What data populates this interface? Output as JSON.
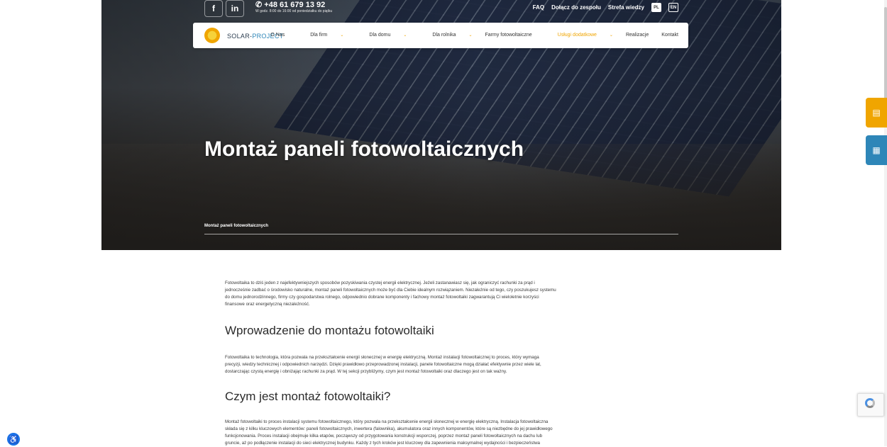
{
  "header": {
    "phone": "+48 61 679 13 92",
    "phone_hours": "W godz. 8:00 do 16:00 od poniedziałku do piątku",
    "social": {
      "facebook": "f",
      "linkedin": "in"
    },
    "top_links": {
      "faq": "FAQ",
      "join": "Dołącz do zespołu",
      "knowledge": "Strefa wiedzy"
    },
    "languages": {
      "pl": "PL",
      "en": "EN"
    }
  },
  "brand": {
    "name_part1": "SOLAR-",
    "name_part2": "PROJECT"
  },
  "nav": {
    "items": [
      {
        "label": "O Nas"
      },
      {
        "label": "Dla firm"
      },
      {
        "label": "Dla domu"
      },
      {
        "label": "Dla rolnika"
      },
      {
        "label": "Farmy fotowoltaiczne"
      },
      {
        "label": "Usługi dodatkowe"
      },
      {
        "label": "Realizacje"
      },
      {
        "label": "Kontakt"
      }
    ],
    "chevron": "⌄"
  },
  "hero": {
    "title": "Montaż paneli fotowoltaicznych",
    "breadcrumb": "Montaż paneli fotowoltaicznych"
  },
  "content": {
    "intro_lines": [
      "Fotowoltaika to dziś jeden z najefektywniejszych sposobów pozyskiwania czystej energii elektrycznej. Jeżeli zastanawiasz się, jak ograniczyć rachunki za prąd i",
      "jednocześnie zadbać o środowisko naturalne, montaż paneli fotowoltaicznych może być dla Ciebie idealnym rozwiązaniem. Niezależnie od tego, czy poszukujesz systemu",
      "do domu jednorodzinnego, firmy czy gospodarstwa rolnego, odpowiednio dobrane komponenty i fachowy montaż fotowoltaiki zagwarantują Ci wieloletnie korzyści",
      "finansowe oraz energetyczną niezależność."
    ],
    "heading1": "Wprowadzenie do montażu fotowoltaiki",
    "para1_lines": [
      "Fotowoltaika to technologia, która pozwala na przekształcenie energii słonecznej w energię elektryczną. Montaż instalacji fotowoltaicznej to proces, który wymaga",
      "precyzji, wiedzy technicznej i odpowiednich narzędzi. Dzięki prawidłowo przeprowadzonej instalacji, panele fotowoltaiczne mogą działać efektywnie przez wiele lat,",
      "dostarczając czystą energię i obniżając rachunki za prąd. W tej sekcji przybliżymy, czym jest montaż fotowoltaiki oraz dlaczego jest on tak ważny."
    ],
    "heading2": "Czym jest montaż fotowoltaiki?",
    "para2_lines": [
      "Montaż fotowoltaiki to proces instalacji systemu fotowoltaicznego, który pozwala na przekształcenie energii słonecznej w energię elektryczną. Instalacja fotowoltaiczna",
      "składa się z kilku kluczowych elementów: paneli fotowoltaicznych, inwertera (falownika), akumulatora oraz innych komponentów, które są niezbędne do jej prawidłowego",
      "funkcjonowania. Proces instalacji obejmuje kilka etapów, począwszy od przygotowania konstrukcji wsporczej, poprzez montaż paneli fotowoltaicznych na dachu lub",
      "gruncie, aż po podłączenie instalacji do sieci elektrycznej budynku. Każdy z tych kroków jest kluczowy dla zapewnienia maksymalnej wydajności i bezpieczeństwa"
    ]
  },
  "icons": {
    "phone": "phone-icon",
    "side_offer": "document-icon",
    "side_calc": "calculator-icon",
    "accessibility": "accessibility-icon"
  },
  "colors": {
    "accent": "#f0a500",
    "blue": "#2e86b8"
  }
}
